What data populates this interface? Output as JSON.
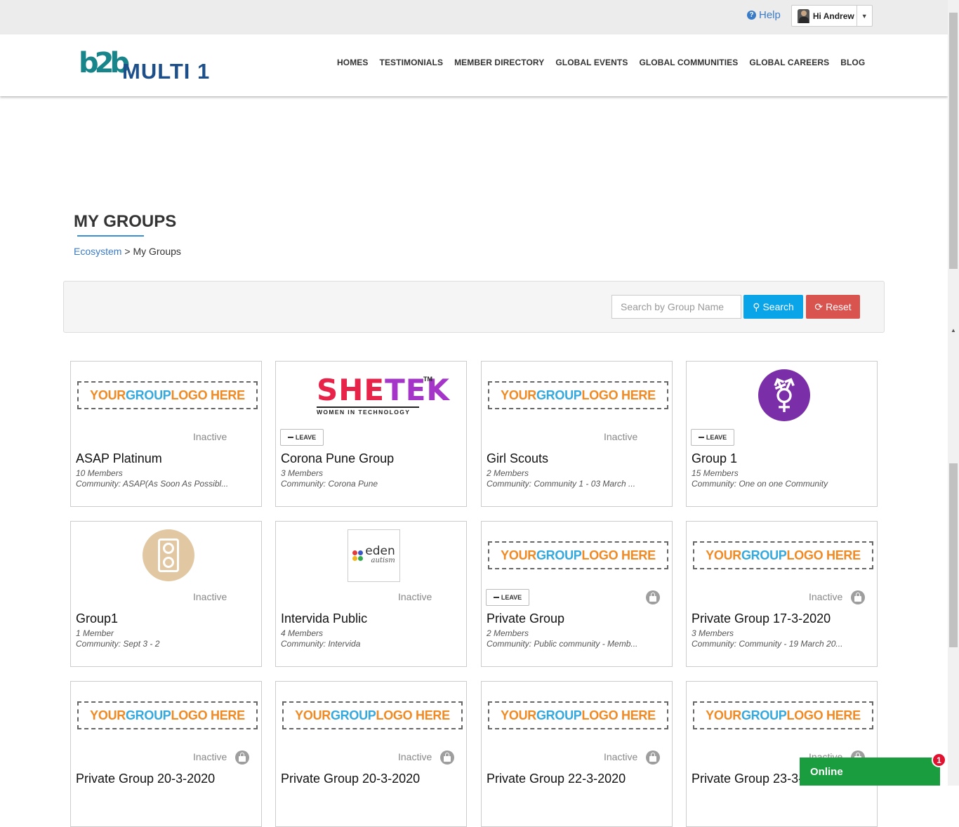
{
  "header": {
    "help_label": "Help",
    "user_greeting": "Hi Andrew",
    "logo_mark": "b2b",
    "logo_text": "MULTI 1",
    "nav": [
      "HOMES",
      "TESTIMONIALS",
      "MEMBER DIRECTORY",
      "GLOBAL EVENTS",
      "GLOBAL COMMUNITIES",
      "GLOBAL CAREERS",
      "BLOG"
    ]
  },
  "page": {
    "title": "MY GROUPS",
    "breadcrumb_link": "Ecosystem",
    "breadcrumb_sep": ">",
    "breadcrumb_current": "My Groups"
  },
  "search": {
    "placeholder": "Search by Group Name",
    "search_label": "Search",
    "reset_label": "Reset"
  },
  "logo_placeholder": {
    "part1": "YOUR ",
    "part2": "GROUP ",
    "part3": "LOGO HERE"
  },
  "shetek_logo": {
    "main1": "SHE",
    "main2": "TEK",
    "tm": "TM",
    "sub": "WOMEN IN TECHNOLOGY"
  },
  "eden_logo": {
    "main": "eden",
    "sub": "autism"
  },
  "gender_icon": "⚧",
  "leave_label": "LEAVE",
  "groups": [
    {
      "name": "ASAP Platinum",
      "members": "10 Members",
      "community": "Community: ASAP(As Soon As Possibl...",
      "status": "Inactive"
    },
    {
      "name": "Corona Pune Group",
      "members": "3 Members",
      "community": "Community: Corona Pune",
      "status": ""
    },
    {
      "name": "Girl Scouts",
      "members": "2 Members",
      "community": "Community: Community 1 - 03 March ...",
      "status": "Inactive"
    },
    {
      "name": "Group 1",
      "members": "15 Members",
      "community": "Community: One on one Community",
      "status": ""
    },
    {
      "name": "Group1",
      "members": "1 Member",
      "community": "Community: Sept 3 - 2",
      "status": "Inactive"
    },
    {
      "name": "Intervida Public",
      "members": "4 Members",
      "community": "Community: Intervida",
      "status": "Inactive"
    },
    {
      "name": "Private Group",
      "members": "2 Members",
      "community": "Community: Public community - Memb...",
      "status": ""
    },
    {
      "name": "Private Group 17-3-2020",
      "members": "3 Members",
      "community": "Community: Community - 19 March 20...",
      "status": "Inactive"
    },
    {
      "name": "Private Group 20-3-2020",
      "members": "",
      "community": "",
      "status": "Inactive"
    },
    {
      "name": "Private Group 20-3-2020",
      "members": "",
      "community": "",
      "status": "Inactive"
    },
    {
      "name": "Private Group 22-3-2020",
      "members": "",
      "community": "",
      "status": "Inactive"
    },
    {
      "name": "Private Group 23-3-",
      "members": "",
      "community": "",
      "status": "Inactive"
    }
  ],
  "chat": {
    "label": "Online",
    "badge": "1"
  },
  "colors": {
    "accent": "#3a7bc8",
    "search_button": "#0aa4e8",
    "reset_button": "#d9534f",
    "online": "#1a9d3f"
  }
}
